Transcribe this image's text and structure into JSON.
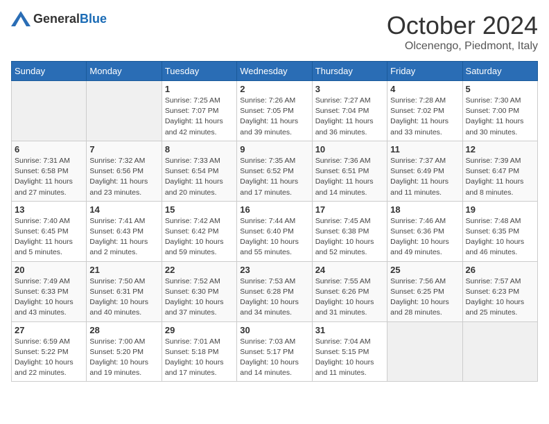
{
  "header": {
    "logo_general": "General",
    "logo_blue": "Blue",
    "month": "October 2024",
    "location": "Olcenengo, Piedmont, Italy"
  },
  "days_of_week": [
    "Sunday",
    "Monday",
    "Tuesday",
    "Wednesday",
    "Thursday",
    "Friday",
    "Saturday"
  ],
  "weeks": [
    [
      {
        "day": "",
        "info": ""
      },
      {
        "day": "",
        "info": ""
      },
      {
        "day": "1",
        "info": "Sunrise: 7:25 AM\nSunset: 7:07 PM\nDaylight: 11 hours and 42 minutes."
      },
      {
        "day": "2",
        "info": "Sunrise: 7:26 AM\nSunset: 7:05 PM\nDaylight: 11 hours and 39 minutes."
      },
      {
        "day": "3",
        "info": "Sunrise: 7:27 AM\nSunset: 7:04 PM\nDaylight: 11 hours and 36 minutes."
      },
      {
        "day": "4",
        "info": "Sunrise: 7:28 AM\nSunset: 7:02 PM\nDaylight: 11 hours and 33 minutes."
      },
      {
        "day": "5",
        "info": "Sunrise: 7:30 AM\nSunset: 7:00 PM\nDaylight: 11 hours and 30 minutes."
      }
    ],
    [
      {
        "day": "6",
        "info": "Sunrise: 7:31 AM\nSunset: 6:58 PM\nDaylight: 11 hours and 27 minutes."
      },
      {
        "day": "7",
        "info": "Sunrise: 7:32 AM\nSunset: 6:56 PM\nDaylight: 11 hours and 23 minutes."
      },
      {
        "day": "8",
        "info": "Sunrise: 7:33 AM\nSunset: 6:54 PM\nDaylight: 11 hours and 20 minutes."
      },
      {
        "day": "9",
        "info": "Sunrise: 7:35 AM\nSunset: 6:52 PM\nDaylight: 11 hours and 17 minutes."
      },
      {
        "day": "10",
        "info": "Sunrise: 7:36 AM\nSunset: 6:51 PM\nDaylight: 11 hours and 14 minutes."
      },
      {
        "day": "11",
        "info": "Sunrise: 7:37 AM\nSunset: 6:49 PM\nDaylight: 11 hours and 11 minutes."
      },
      {
        "day": "12",
        "info": "Sunrise: 7:39 AM\nSunset: 6:47 PM\nDaylight: 11 hours and 8 minutes."
      }
    ],
    [
      {
        "day": "13",
        "info": "Sunrise: 7:40 AM\nSunset: 6:45 PM\nDaylight: 11 hours and 5 minutes."
      },
      {
        "day": "14",
        "info": "Sunrise: 7:41 AM\nSunset: 6:43 PM\nDaylight: 11 hours and 2 minutes."
      },
      {
        "day": "15",
        "info": "Sunrise: 7:42 AM\nSunset: 6:42 PM\nDaylight: 10 hours and 59 minutes."
      },
      {
        "day": "16",
        "info": "Sunrise: 7:44 AM\nSunset: 6:40 PM\nDaylight: 10 hours and 55 minutes."
      },
      {
        "day": "17",
        "info": "Sunrise: 7:45 AM\nSunset: 6:38 PM\nDaylight: 10 hours and 52 minutes."
      },
      {
        "day": "18",
        "info": "Sunrise: 7:46 AM\nSunset: 6:36 PM\nDaylight: 10 hours and 49 minutes."
      },
      {
        "day": "19",
        "info": "Sunrise: 7:48 AM\nSunset: 6:35 PM\nDaylight: 10 hours and 46 minutes."
      }
    ],
    [
      {
        "day": "20",
        "info": "Sunrise: 7:49 AM\nSunset: 6:33 PM\nDaylight: 10 hours and 43 minutes."
      },
      {
        "day": "21",
        "info": "Sunrise: 7:50 AM\nSunset: 6:31 PM\nDaylight: 10 hours and 40 minutes."
      },
      {
        "day": "22",
        "info": "Sunrise: 7:52 AM\nSunset: 6:30 PM\nDaylight: 10 hours and 37 minutes."
      },
      {
        "day": "23",
        "info": "Sunrise: 7:53 AM\nSunset: 6:28 PM\nDaylight: 10 hours and 34 minutes."
      },
      {
        "day": "24",
        "info": "Sunrise: 7:55 AM\nSunset: 6:26 PM\nDaylight: 10 hours and 31 minutes."
      },
      {
        "day": "25",
        "info": "Sunrise: 7:56 AM\nSunset: 6:25 PM\nDaylight: 10 hours and 28 minutes."
      },
      {
        "day": "26",
        "info": "Sunrise: 7:57 AM\nSunset: 6:23 PM\nDaylight: 10 hours and 25 minutes."
      }
    ],
    [
      {
        "day": "27",
        "info": "Sunrise: 6:59 AM\nSunset: 5:22 PM\nDaylight: 10 hours and 22 minutes."
      },
      {
        "day": "28",
        "info": "Sunrise: 7:00 AM\nSunset: 5:20 PM\nDaylight: 10 hours and 19 minutes."
      },
      {
        "day": "29",
        "info": "Sunrise: 7:01 AM\nSunset: 5:18 PM\nDaylight: 10 hours and 17 minutes."
      },
      {
        "day": "30",
        "info": "Sunrise: 7:03 AM\nSunset: 5:17 PM\nDaylight: 10 hours and 14 minutes."
      },
      {
        "day": "31",
        "info": "Sunrise: 7:04 AM\nSunset: 5:15 PM\nDaylight: 10 hours and 11 minutes."
      },
      {
        "day": "",
        "info": ""
      },
      {
        "day": "",
        "info": ""
      }
    ]
  ]
}
